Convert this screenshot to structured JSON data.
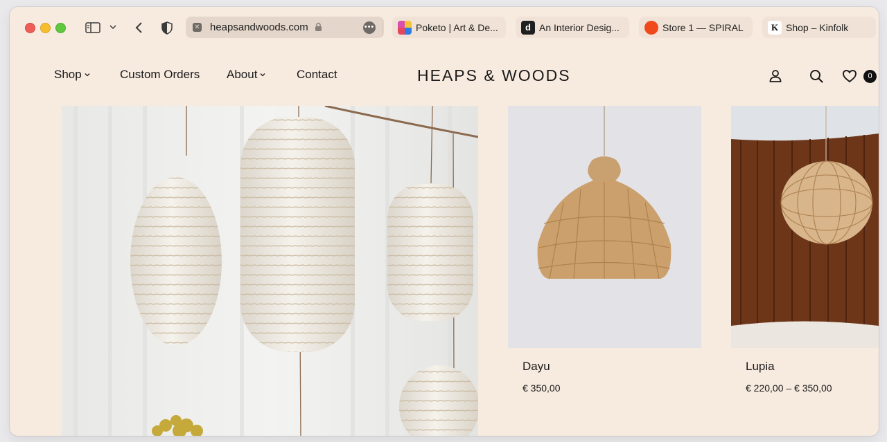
{
  "browser": {
    "address": "heapsandwoods.com",
    "tabs": [
      {
        "label": "Poketo | Art & De..."
      },
      {
        "label": "An Interior Desig...",
        "favicon_text": "d"
      },
      {
        "label": "Store 1 — SPIRAL"
      },
      {
        "label": "Shop – Kinfolk",
        "favicon_text": "K"
      }
    ]
  },
  "site": {
    "logo": "HEAPS & WOODS",
    "nav": [
      {
        "label": "Shop"
      },
      {
        "label": "Custom Orders"
      },
      {
        "label": "About"
      },
      {
        "label": "Contact"
      }
    ],
    "wishlist_count": "0"
  },
  "products": [
    {
      "name": "Dayu",
      "price": "€ 350,00"
    },
    {
      "name": "Lupia",
      "price": "€ 220,00 – € 350,00"
    }
  ],
  "colors": {
    "background": "#f7eadf",
    "text": "#1a1a1a",
    "address_bar": "#e4d6ca"
  },
  "icons": [
    "sidebar-icon",
    "chevron-down-icon",
    "back-icon",
    "shield-icon",
    "lock-icon",
    "more-icon",
    "account-icon",
    "search-icon",
    "heart-icon"
  ]
}
